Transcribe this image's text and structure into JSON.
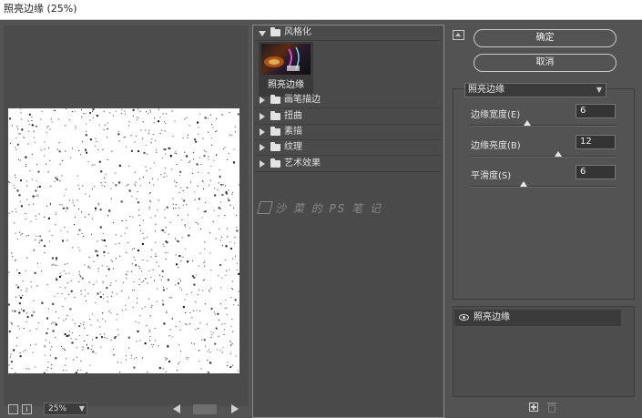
{
  "window": {
    "title": "照亮边缘 (25%)"
  },
  "preview": {
    "zoom": "25%",
    "noise_seed": 7
  },
  "gallery": {
    "open_category": "风格化",
    "selected_filter": "照亮边缘",
    "categories": [
      "画笔描边",
      "扭曲",
      "素描",
      "纹理",
      "艺术效果"
    ],
    "watermark": "沙 菜 的  PS  笔 记"
  },
  "actions": {
    "ok": "确定",
    "cancel": "取消"
  },
  "settings": {
    "filter": "照亮边缘",
    "params": [
      {
        "label": "边缘宽度(E)",
        "value": "6",
        "level": 0.39
      },
      {
        "label": "边缘亮度(B)",
        "value": "12",
        "level": 0.6
      },
      {
        "label": "平滑度(S)",
        "value": "6",
        "level": 0.36
      }
    ]
  },
  "layers": {
    "items": [
      "照亮边缘"
    ]
  },
  "icons": {
    "collapse": "collapse-up-icon",
    "new_layer": "new-effect-layer-icon",
    "delete": "trash-icon",
    "visibility": "eye-icon",
    "folder": "folder-icon"
  }
}
